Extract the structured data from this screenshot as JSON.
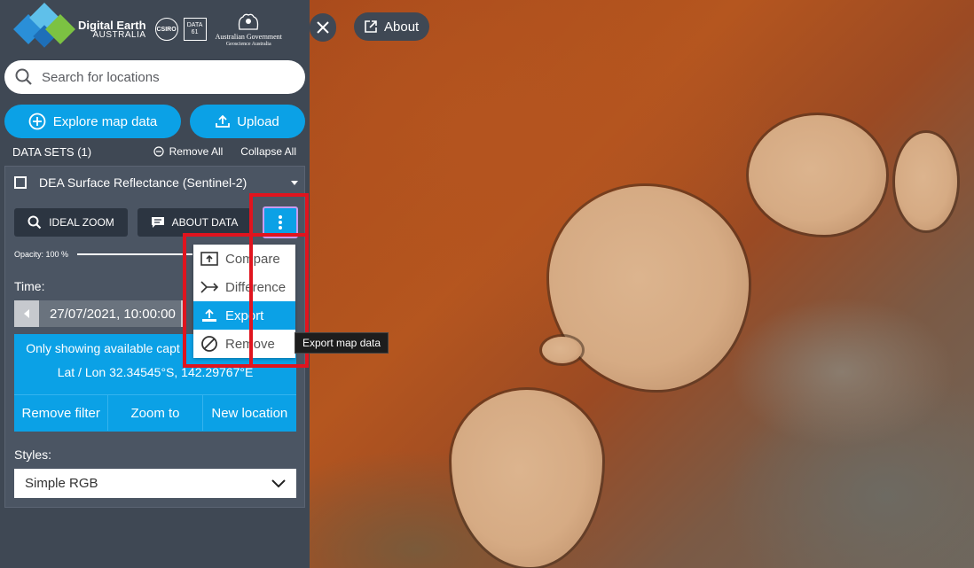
{
  "header": {
    "brand_line1": "Digital Earth",
    "brand_line2": "AUSTRALIA",
    "csiro": "CSIRO",
    "data61_line1": "DATA",
    "data61_line2": "61",
    "gov_line1": "Australian Government",
    "gov_line2": "Geoscience Australia"
  },
  "search": {
    "placeholder": "Search for locations"
  },
  "actions": {
    "explore_label": "Explore map data",
    "upload_label": "Upload"
  },
  "datasets": {
    "header_label": "DATA SETS (1)",
    "remove_all_label": "Remove All",
    "collapse_all_label": "Collapse All"
  },
  "layer": {
    "title": "DEA Surface Reflectance (Sentinel-2)",
    "ideal_zoom_label": "IDEAL ZOOM",
    "about_data_label": "ABOUT DATA",
    "opacity_label": "Opacity: 100 %",
    "opacity_value": 1.0,
    "time_label": "Time:",
    "time_value": "27/07/2021, 10:00:00",
    "filter_text": "Only showing available capt",
    "filter_coords": "Lat / Lon 32.34545°S, 142.29767°E",
    "remove_filter_label": "Remove filter",
    "zoom_to_label": "Zoom to",
    "new_location_label": "New location",
    "styles_label": "Styles:",
    "style_value": "Simple RGB"
  },
  "menu": {
    "items": [
      {
        "label": "Compare",
        "icon": "compare-icon"
      },
      {
        "label": "Difference",
        "icon": "difference-icon"
      },
      {
        "label": "Export",
        "icon": "export-icon"
      },
      {
        "label": "Remove",
        "icon": "remove-icon"
      }
    ],
    "active_index": 2
  },
  "tooltip": {
    "text": "Export map data"
  },
  "map": {
    "about_label": "About"
  },
  "colors": {
    "accent": "#0ba1e6",
    "panel": "#3f4854",
    "highlight": "#e0141e"
  }
}
